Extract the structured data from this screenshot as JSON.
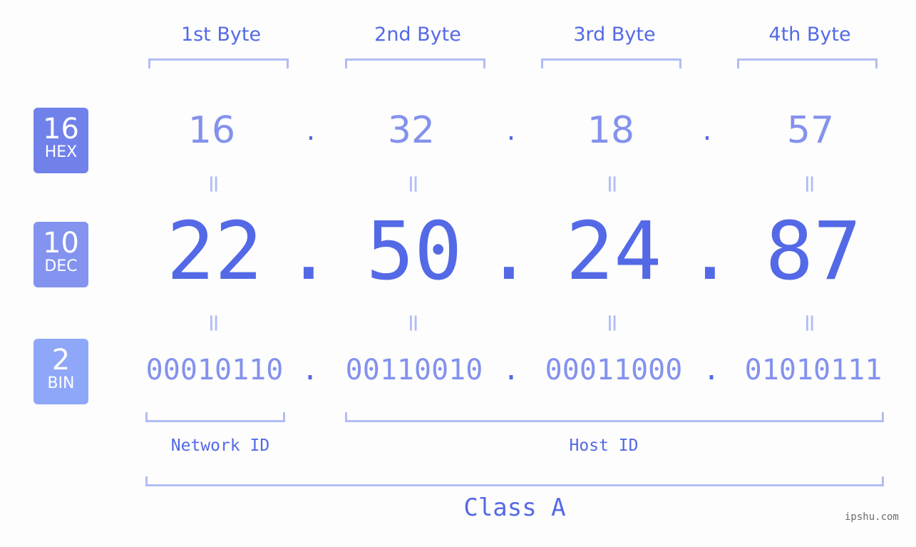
{
  "bytes": [
    {
      "label": "1st Byte",
      "hex": "16",
      "dec": "22",
      "bin": "00010110"
    },
    {
      "label": "2nd Byte",
      "hex": "32",
      "dec": "50",
      "bin": "00110010"
    },
    {
      "label": "3rd Byte",
      "hex": "18",
      "dec": "24",
      "bin": "00011000"
    },
    {
      "label": "4th Byte",
      "hex": "57",
      "dec": "87",
      "bin": "01010111"
    }
  ],
  "bases": {
    "hex": {
      "number": "16",
      "label": "HEX",
      "color": "#7181ea"
    },
    "dec": {
      "number": "10",
      "label": "DEC",
      "color": "#8393ef"
    },
    "bin": {
      "number": "2",
      "label": "BIN",
      "color": "#8ea7f9"
    }
  },
  "separator": ".",
  "equals": "=",
  "network_id_label": "Network ID",
  "host_id_label": "Host ID",
  "class_label": "Class A",
  "brand": "ipshu.com",
  "colors": {
    "accent": "#5469e6",
    "light": "#8491ed",
    "bracket": "#b1bcf6"
  }
}
